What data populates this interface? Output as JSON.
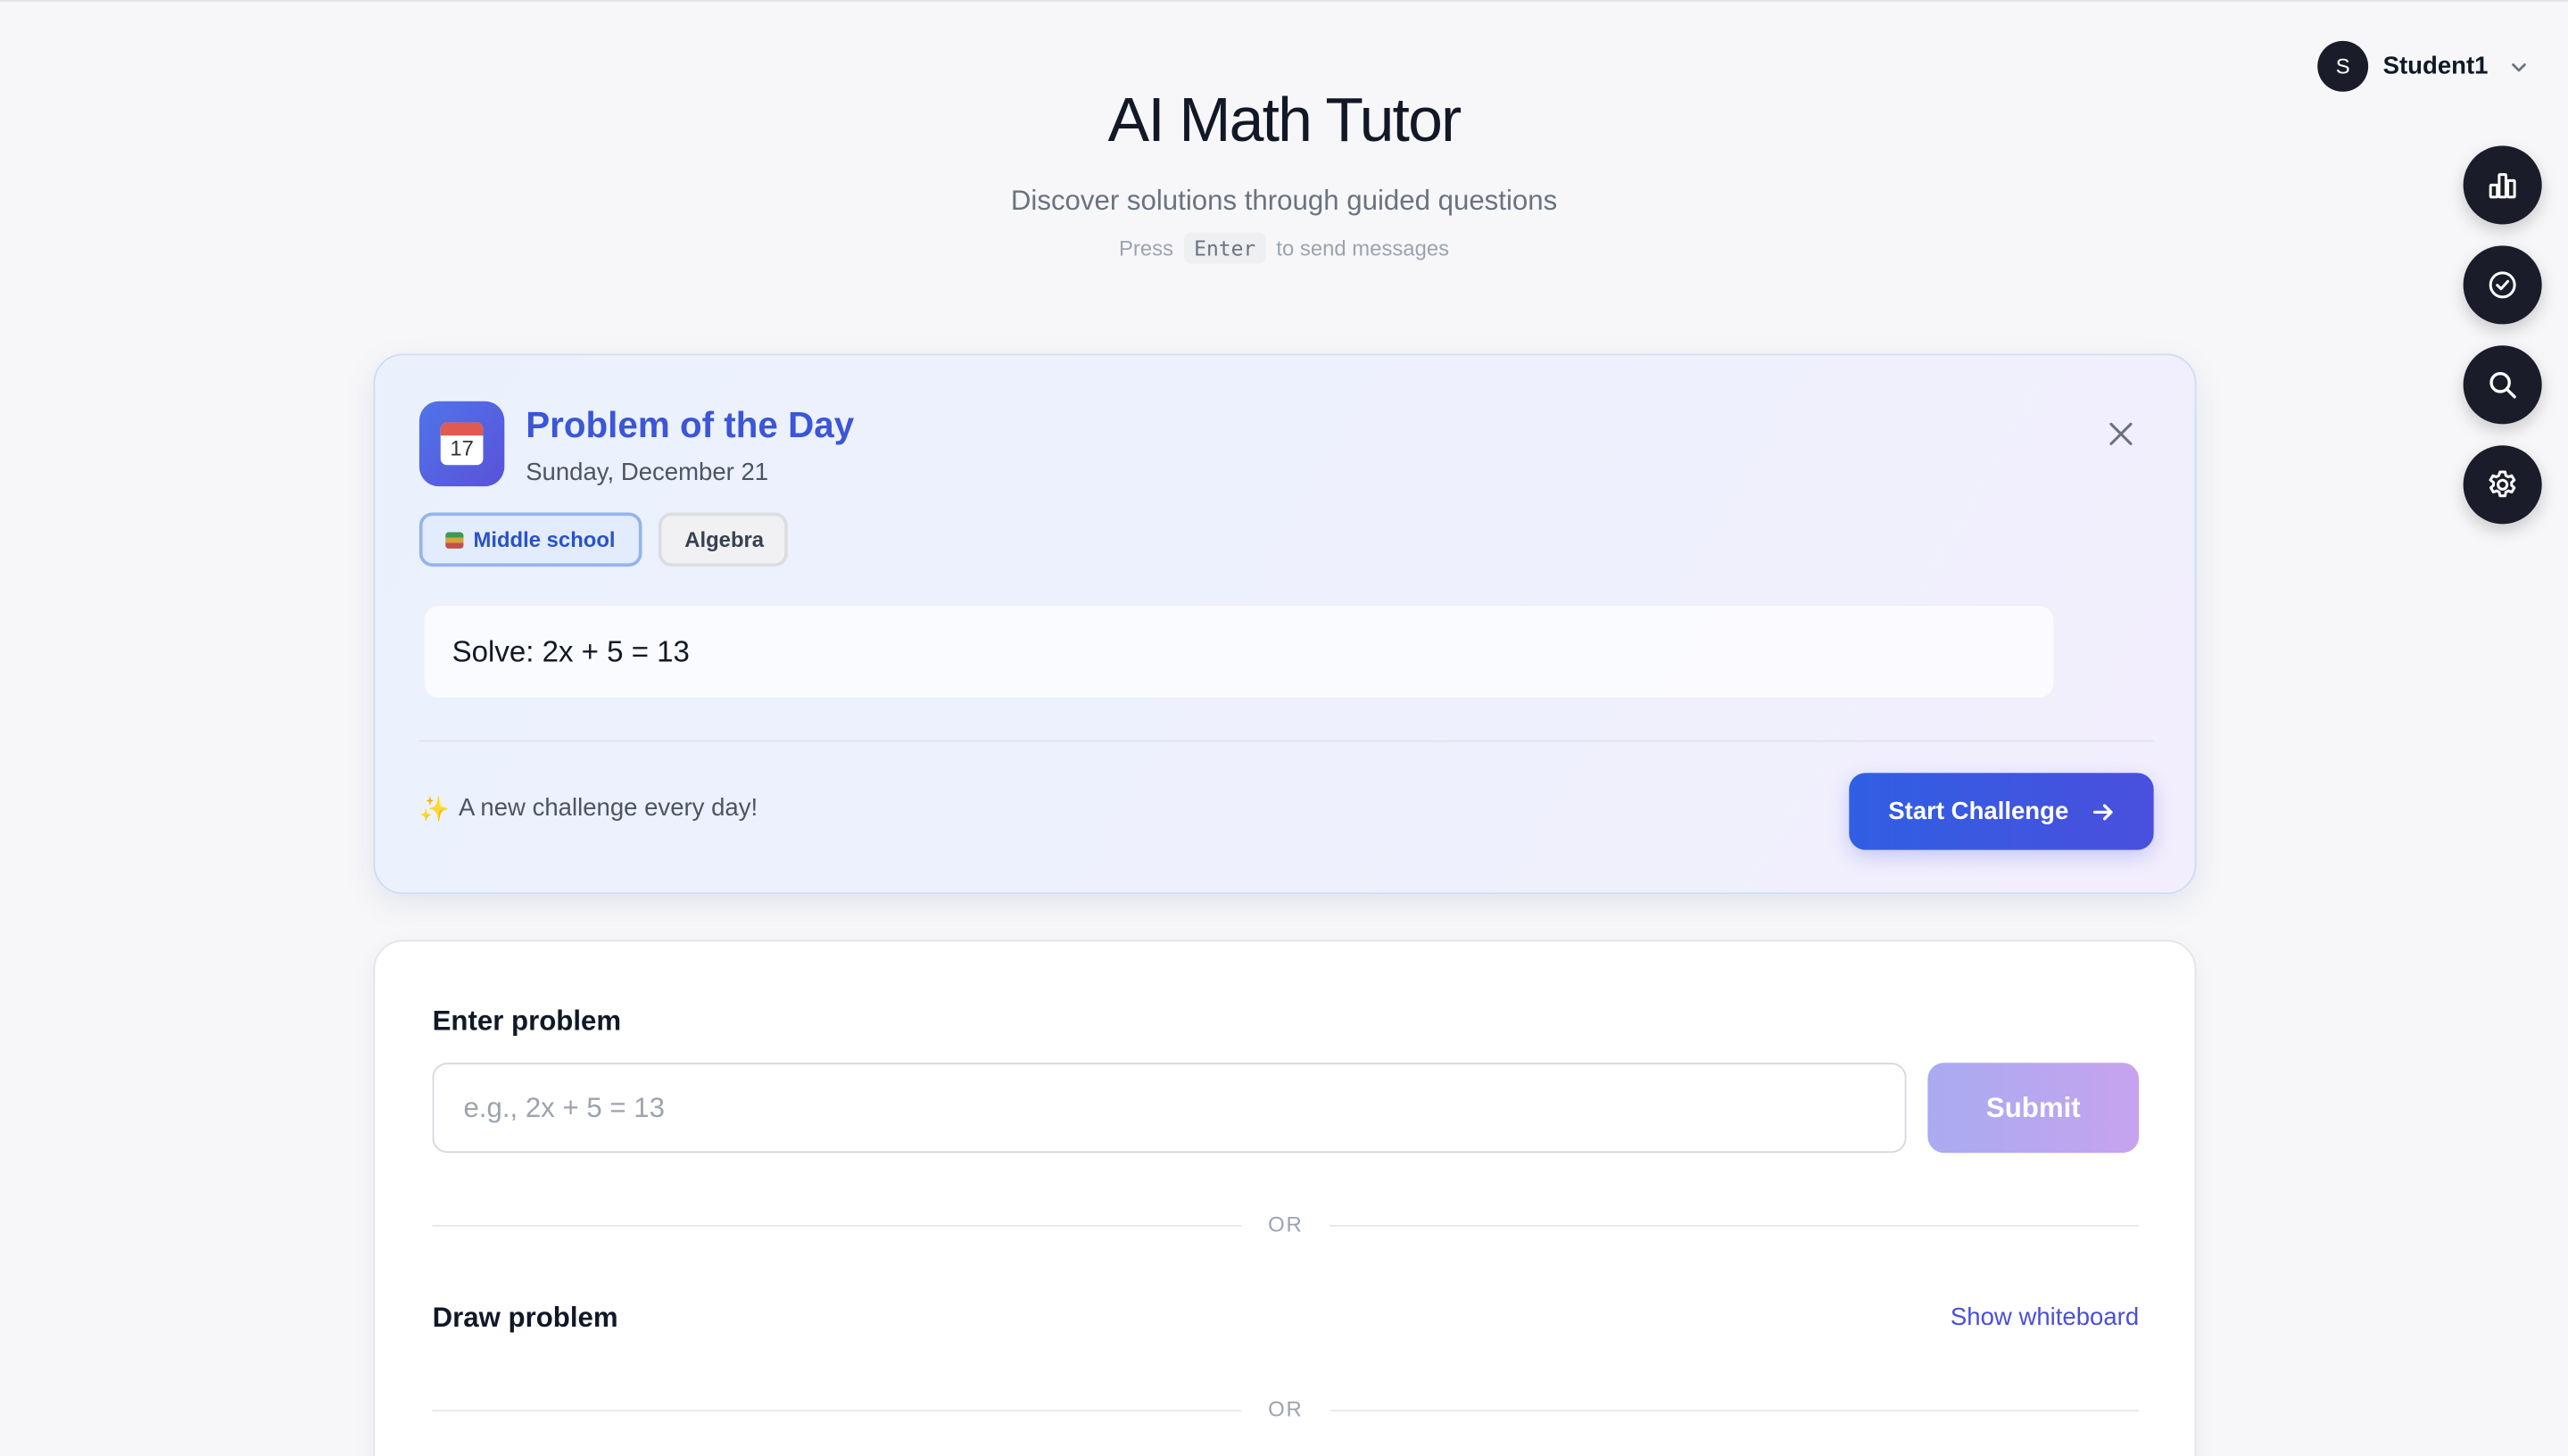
{
  "user": {
    "initial": "S",
    "name": "Student1"
  },
  "fabs": [
    {
      "name": "stats-button",
      "icon": "bar-chart-icon"
    },
    {
      "name": "progress-button",
      "icon": "check-circle-icon"
    },
    {
      "name": "search-button",
      "icon": "search-icon"
    },
    {
      "name": "settings-button",
      "icon": "gear-icon"
    }
  ],
  "header": {
    "title": "AI Math Tutor",
    "subtitle": "Discover solutions through guided questions",
    "hint_prefix": "Press",
    "hint_key": "Enter",
    "hint_suffix": "to send messages"
  },
  "problem_of_the_day": {
    "title": "Problem of the Day",
    "date": "Sunday, December 21",
    "calendar_day": "17",
    "tags": {
      "level": "Middle school",
      "topic": "Algebra"
    },
    "problem": "Solve: 2x + 5 = 13",
    "tagline": "A new challenge every day!",
    "start_label": "Start Challenge"
  },
  "entry": {
    "enter_label": "Enter problem",
    "input_placeholder": "e.g., 2x + 5 = 13",
    "input_value": "",
    "submit_label": "Submit",
    "or_label": "OR",
    "draw_label": "Draw problem",
    "whiteboard_link": "Show whiteboard"
  },
  "colors": {
    "accent": "#3b56d6",
    "button_start": "#2f5fe3",
    "button_end": "#4a4fdd",
    "fab_bg": "#1a1d29"
  }
}
